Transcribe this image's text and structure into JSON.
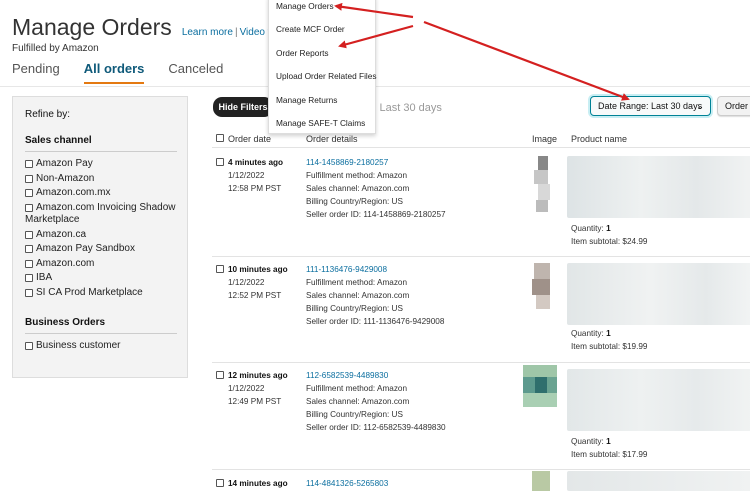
{
  "header": {
    "title": "Manage Orders",
    "learn_more": "Learn more",
    "separator": "|",
    "video_tutorials": "Video tutorials",
    "subtitle": "Fulfilled by Amazon"
  },
  "tabs": [
    {
      "label": "Pending"
    },
    {
      "label": "All orders",
      "active": true
    },
    {
      "label": "Canceled"
    }
  ],
  "refine": {
    "heading": "Refine by:",
    "sales_channel_heading": "Sales channel",
    "sales_channels": [
      {
        "label": "Amazon Pay"
      },
      {
        "label": "Non-Amazon"
      },
      {
        "label": "Amazon.com.mx"
      },
      {
        "label": "Amazon.com Invoicing Shadow Marketplace"
      },
      {
        "label": "Amazon.ca"
      },
      {
        "label": "Amazon Pay Sandbox"
      },
      {
        "label": "Amazon.com"
      },
      {
        "label": "IBA"
      },
      {
        "label": "SI CA Prod Marketplace"
      }
    ],
    "business_heading": "Business Orders",
    "business_options": [
      {
        "label": "Business customer"
      }
    ]
  },
  "filter_bar": {
    "hide_filters": "Hide Filters",
    "active_filter": "Last 30 days",
    "date_range": "Date Range: Last 30 days",
    "order_button": "Order"
  },
  "columns": {
    "order_date": "Order date",
    "order_details": "Order details",
    "image": "Image",
    "product_name": "Product name"
  },
  "orders": [
    {
      "age": "4 minutes ago",
      "date": "1/12/2022",
      "time": "12:58 PM PST",
      "order_id": "114-1458869-2180257",
      "fulfillment": "Fulfillment method: Amazon",
      "channel": "Sales channel: Amazon.com",
      "region": "Billing Country/Region: US",
      "seller_id": "Seller order ID: 114-1458869-2180257",
      "qty_label": "Quantity:",
      "qty": "1",
      "subtotal": "Item subtotal: $24.99"
    },
    {
      "age": "10 minutes ago",
      "date": "1/12/2022",
      "time": "12:52 PM PST",
      "order_id": "111-1136476-9429008",
      "fulfillment": "Fulfillment method: Amazon",
      "channel": "Sales channel: Amazon.com",
      "region": "Billing Country/Region: US",
      "seller_id": "Seller order ID: 111-1136476-9429008",
      "qty_label": "Quantity:",
      "qty": "1",
      "subtotal": "Item subtotal: $19.99"
    },
    {
      "age": "12 minutes ago",
      "date": "1/12/2022",
      "time": "12:49 PM PST",
      "order_id": "112-6582539-4489830",
      "fulfillment": "Fulfillment method: Amazon",
      "channel": "Sales channel: Amazon.com",
      "region": "Billing Country/Region: US",
      "seller_id": "Seller order ID: 112-6582539-4489830",
      "qty_label": "Quantity:",
      "qty": "1",
      "subtotal": "Item subtotal: $17.99"
    },
    {
      "age": "14 minutes ago",
      "order_id": "114-4841326-5265803"
    }
  ],
  "menu": {
    "items": [
      {
        "label": "Manage Orders"
      },
      {
        "label": "Create MCF Order"
      },
      {
        "label": "Order Reports"
      },
      {
        "label": "Upload Order Related Files"
      },
      {
        "label": "Manage Returns"
      },
      {
        "label": "Manage SAFE-T Claims"
      }
    ]
  },
  "colors": {
    "link": "#0b6e9f",
    "tab_active_underline": "#e47911",
    "annotation_arrow": "#d42020",
    "date_range_border": "#008296"
  }
}
